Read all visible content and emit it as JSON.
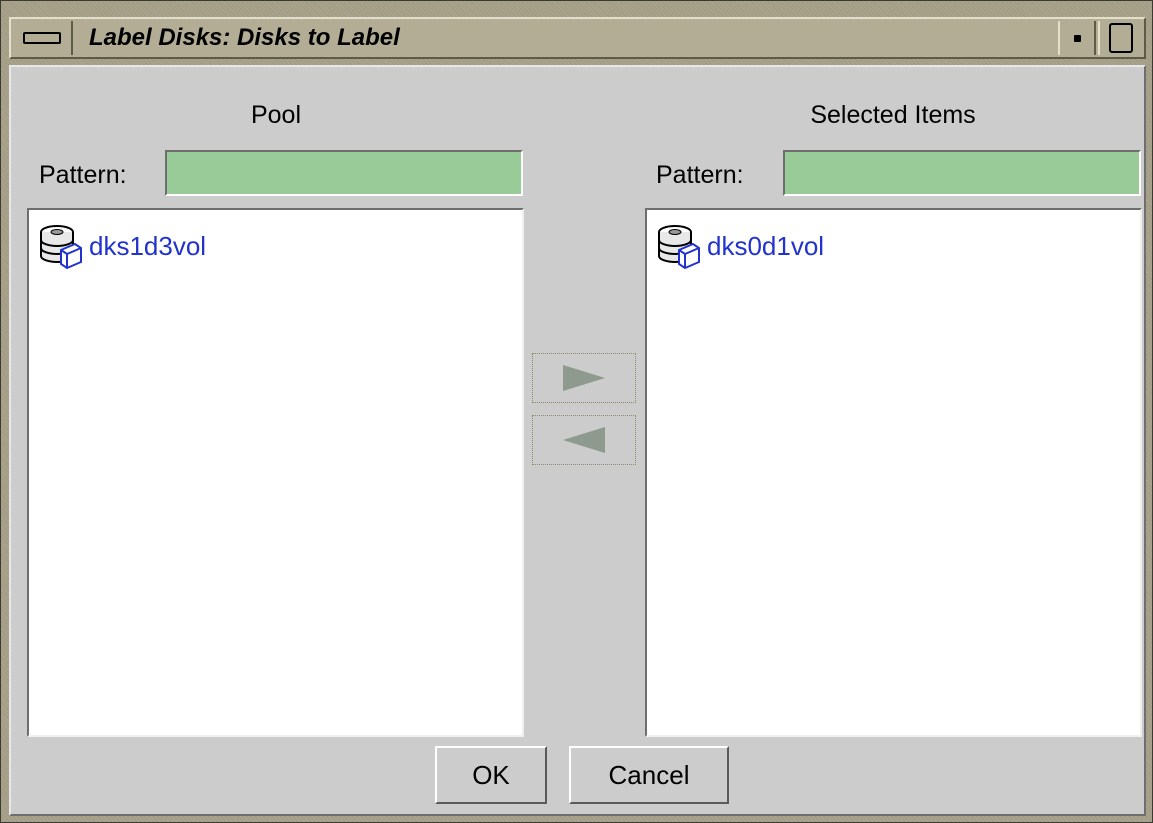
{
  "window": {
    "title": "Label Disks: Disks to Label",
    "menu_icon": "window-menu-icon",
    "minimize_icon": "minimize-icon",
    "maximize_icon": "maximize-icon"
  },
  "pool": {
    "heading": "Pool",
    "pattern_label": "Pattern:",
    "pattern_value": "",
    "items": [
      {
        "label": "dks1d3vol",
        "icon": "disk-volume-icon"
      }
    ]
  },
  "selected": {
    "heading": "Selected Items",
    "pattern_label": "Pattern:",
    "pattern_value": "",
    "items": [
      {
        "label": "dks0d1vol",
        "icon": "disk-volume-icon"
      }
    ]
  },
  "transfer": {
    "add_icon": "arrow-right-icon",
    "remove_icon": "arrow-left-icon"
  },
  "buttons": {
    "ok": "OK",
    "cancel": "Cancel"
  },
  "colors": {
    "client_bg": "#cccccc",
    "pattern_field": "#99cb99",
    "item_text": "#2233cc",
    "titlebar": "#b3ad96"
  }
}
